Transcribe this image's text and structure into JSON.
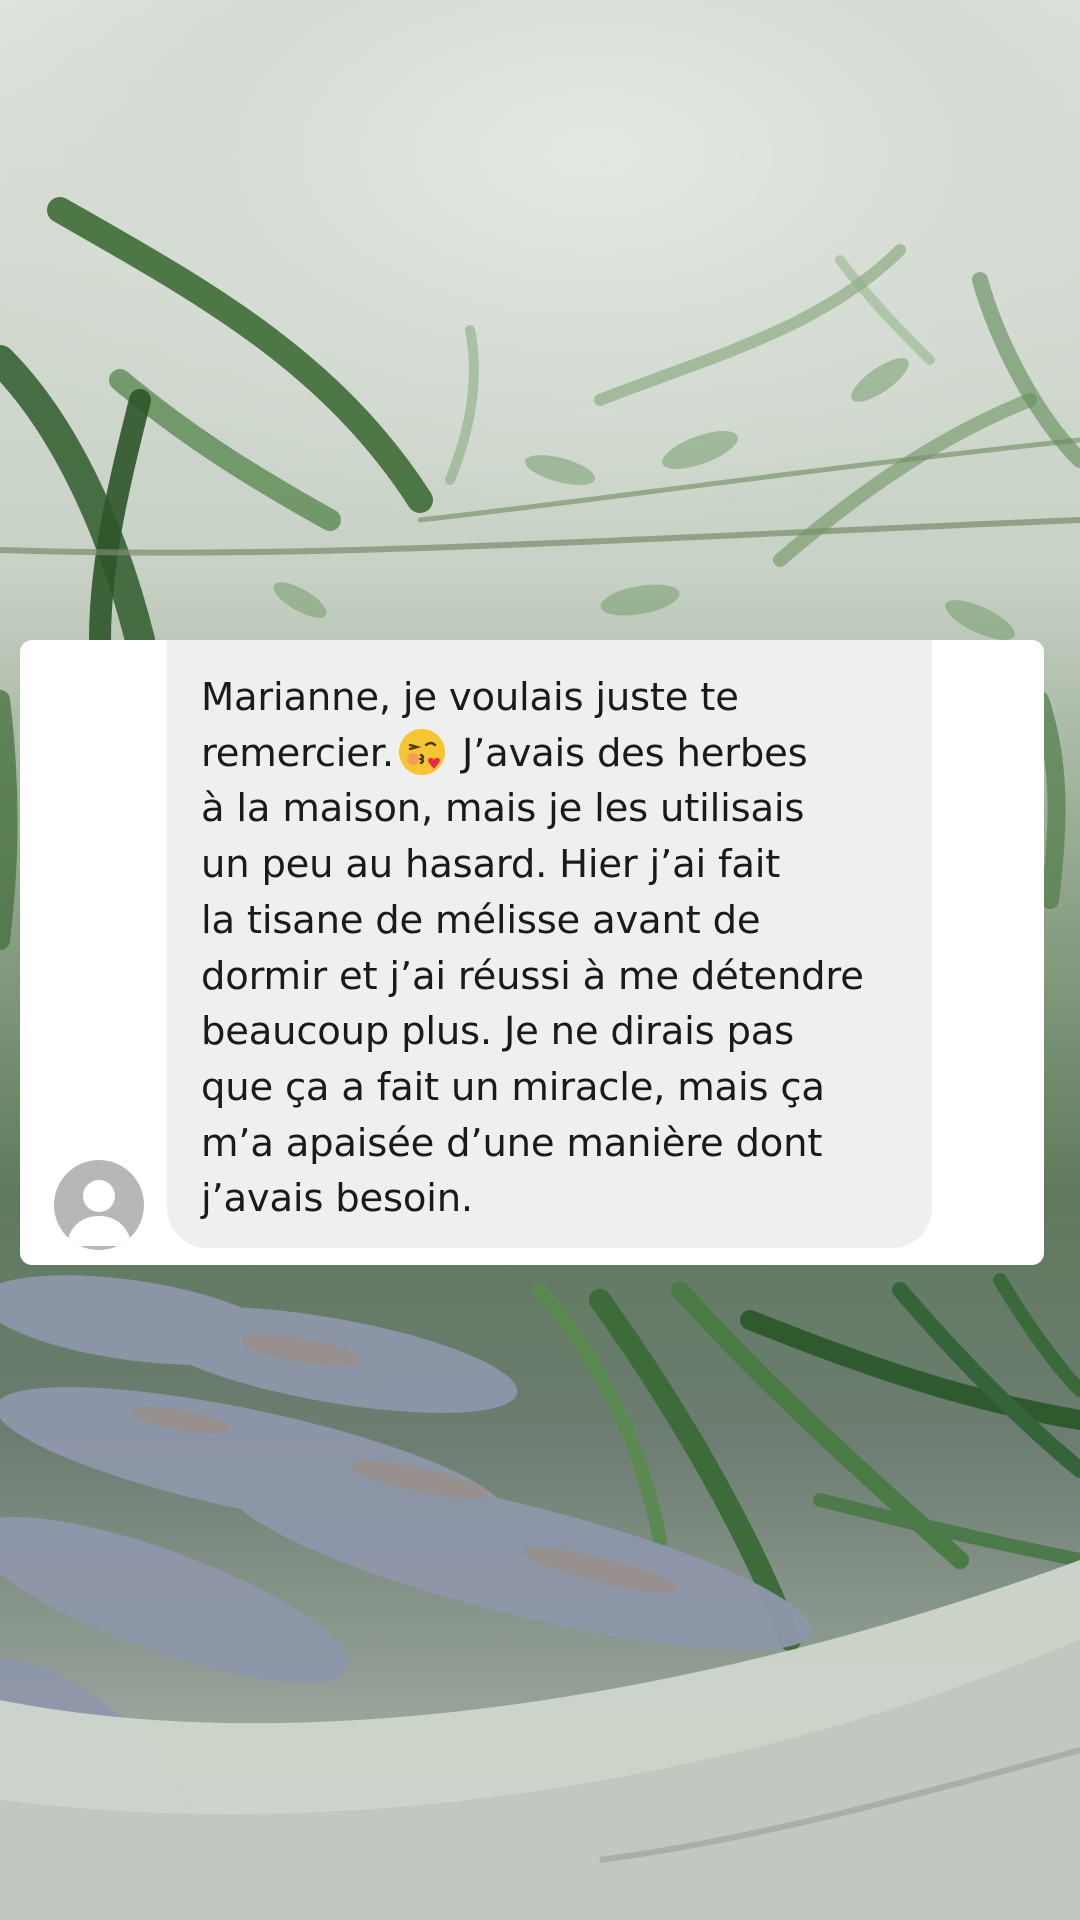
{
  "background": {
    "description_icon": "herbs-photo",
    "colors": {
      "sage": "#8aa085",
      "lavender": "#8b93a6",
      "bowl": "#c9d0c6"
    }
  },
  "conversation": {
    "sender_avatar_icon": "default-user-avatar-icon",
    "message": {
      "line_1": "Marianne, je voulais juste te",
      "line_2_before_emoji": "remercier.",
      "emoji_icon": "face-blowing-a-kiss-emoji",
      "line_2_after_emoji": "J’avais des herbes",
      "rest": "à la maison, mais je les utilisais\nun peu au hasard. Hier j’ai fait\nla tisane de mélisse avant de\ndormir et j’ai réussi à me détendre\nbeaucoup plus. Je ne dirais pas\nque ça a fait un miracle, mais ça\nm’a apaisée d’une manière dont\nj’avais besoin."
    },
    "colors": {
      "card": "#ffffff",
      "bubble": "#efefef",
      "text": "#1a1a1a",
      "avatar": "#b7b7b7"
    }
  }
}
